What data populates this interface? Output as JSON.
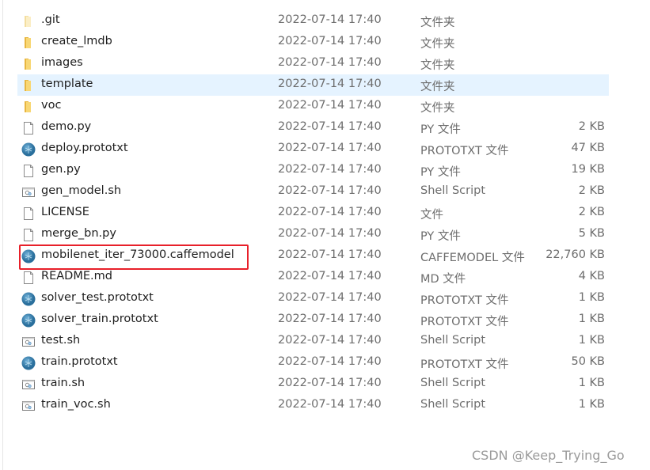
{
  "files": [
    {
      "name": ".git",
      "date": "2022-07-14 17:40",
      "type": "文件夹",
      "size": "",
      "icon": "folder-light-icon"
    },
    {
      "name": "create_lmdb",
      "date": "2022-07-14 17:40",
      "type": "文件夹",
      "size": "",
      "icon": "folder-icon"
    },
    {
      "name": "images",
      "date": "2022-07-14 17:40",
      "type": "文件夹",
      "size": "",
      "icon": "folder-icon"
    },
    {
      "name": "template",
      "date": "2022-07-14 17:40",
      "type": "文件夹",
      "size": "",
      "icon": "folder-icon",
      "selected": true
    },
    {
      "name": "voc",
      "date": "2022-07-14 17:40",
      "type": "文件夹",
      "size": "",
      "icon": "folder-icon"
    },
    {
      "name": "demo.py",
      "date": "2022-07-14 17:40",
      "type": "PY 文件",
      "size": "2 KB",
      "icon": "file-icon"
    },
    {
      "name": "deploy.prototxt",
      "date": "2022-07-14 17:40",
      "type": "PROTOTXT 文件",
      "size": "47 KB",
      "icon": "globe-file-icon"
    },
    {
      "name": "gen.py",
      "date": "2022-07-14 17:40",
      "type": "PY 文件",
      "size": "19 KB",
      "icon": "file-icon"
    },
    {
      "name": "gen_model.sh",
      "date": "2022-07-14 17:40",
      "type": "Shell Script",
      "size": "2 KB",
      "icon": "script-icon"
    },
    {
      "name": "LICENSE",
      "date": "2022-07-14 17:40",
      "type": "文件",
      "size": "2 KB",
      "icon": "file-icon"
    },
    {
      "name": "merge_bn.py",
      "date": "2022-07-14 17:40",
      "type": "PY 文件",
      "size": "5 KB",
      "icon": "file-icon"
    },
    {
      "name": "mobilenet_iter_73000.caffemodel",
      "date": "2022-07-14 17:40",
      "type": "CAFFEMODEL 文件",
      "size": "22,760 KB",
      "icon": "globe-file-icon",
      "highlighted": true
    },
    {
      "name": "README.md",
      "date": "2022-07-14 17:40",
      "type": "MD 文件",
      "size": "4 KB",
      "icon": "file-icon"
    },
    {
      "name": "solver_test.prototxt",
      "date": "2022-07-14 17:40",
      "type": "PROTOTXT 文件",
      "size": "1 KB",
      "icon": "globe-file-icon"
    },
    {
      "name": "solver_train.prototxt",
      "date": "2022-07-14 17:40",
      "type": "PROTOTXT 文件",
      "size": "1 KB",
      "icon": "globe-file-icon"
    },
    {
      "name": "test.sh",
      "date": "2022-07-14 17:40",
      "type": "Shell Script",
      "size": "1 KB",
      "icon": "script-icon"
    },
    {
      "name": "train.prototxt",
      "date": "2022-07-14 17:40",
      "type": "PROTOTXT 文件",
      "size": "50 KB",
      "icon": "globe-file-icon"
    },
    {
      "name": "train.sh",
      "date": "2022-07-14 17:40",
      "type": "Shell Script",
      "size": "1 KB",
      "icon": "script-icon"
    },
    {
      "name": "train_voc.sh",
      "date": "2022-07-14 17:40",
      "type": "Shell Script",
      "size": "1 KB",
      "icon": "script-icon"
    }
  ],
  "colors": {
    "selection": "#e5f3ff",
    "highlight_box": "#e8202a"
  },
  "watermark": "CSDN @Keep_Trying_Go"
}
